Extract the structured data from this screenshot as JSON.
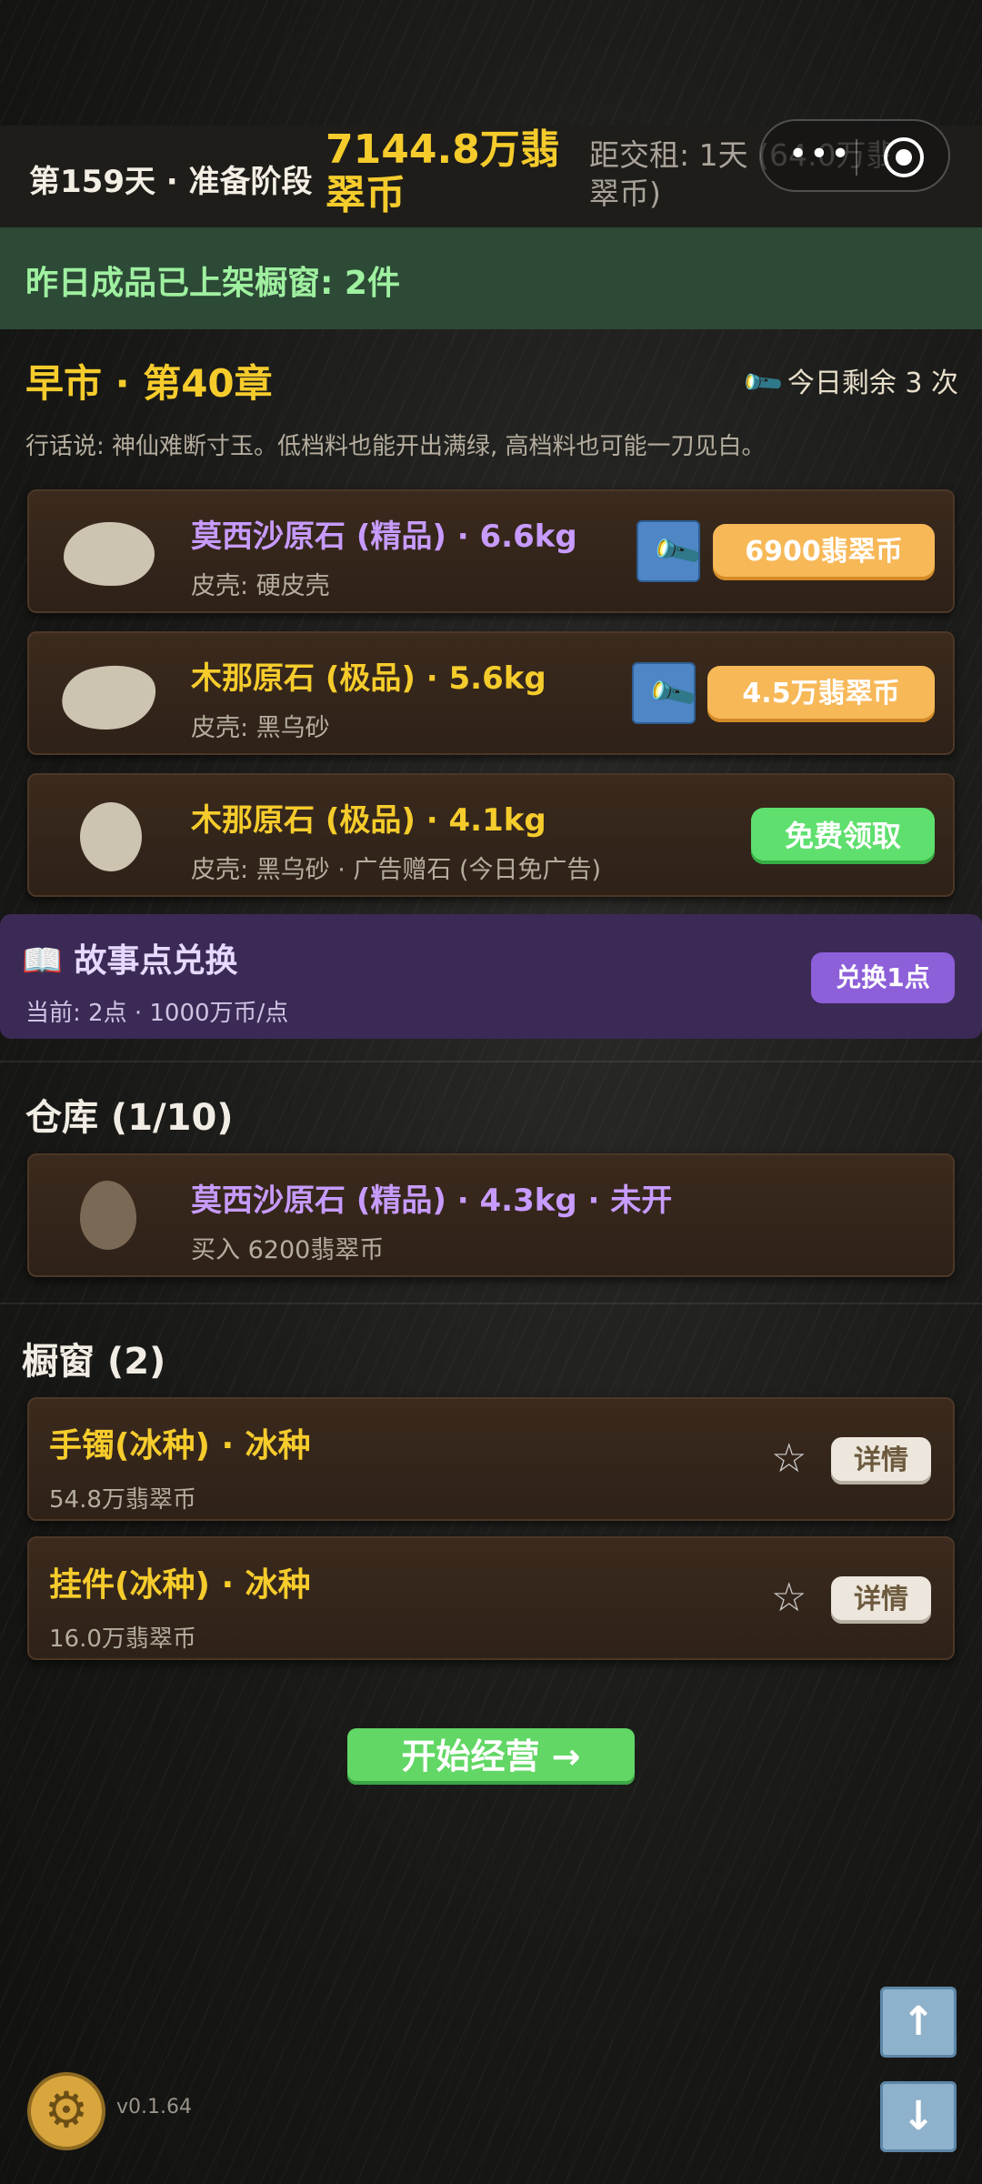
{
  "header": {
    "day_phase": "第159天 · 准备阶段",
    "money": "7144.8万翡翠币",
    "rent_line1": "距交租: 1天 (64.0万翡",
    "rent_line2": "翠币)"
  },
  "banner": {
    "text": "昨日成品已上架橱窗: 2件"
  },
  "market": {
    "title": "早市 · 第40章",
    "remaining": "今日剩余 3 次",
    "saying": "行话说: 神仙难断寸玉。低档料也能开出满绿, 高档料也可能一刀见白。",
    "items": [
      {
        "name": "莫西沙原石 (精品) · 6.6kg",
        "sub": "皮壳: 硬皮壳",
        "price": "6900翡翠币"
      },
      {
        "name": "木那原石 (极品) · 5.6kg",
        "sub": "皮壳: 黑乌砂",
        "price": "4.5万翡翠币"
      },
      {
        "name": "木那原石 (极品) · 4.1kg",
        "sub": "皮壳: 黑乌砂 · 广告赠石 (今日免广告)",
        "action": "免费领取"
      }
    ]
  },
  "story": {
    "icon": "book-icon",
    "title": "故事点兑换",
    "sub": "当前: 2点 · 1000万币/点",
    "button": "兑换1点"
  },
  "warehouse": {
    "title": "仓库 (1/10)",
    "items": [
      {
        "name": "莫西沙原石 (精品) · 4.3kg · 未开",
        "sub": "买入 6200翡翠币"
      }
    ]
  },
  "showcase": {
    "title": "橱窗 (2)",
    "items": [
      {
        "name": "手镯(冰种) · 冰种",
        "price": "54.8万翡翠币",
        "button": "详情"
      },
      {
        "name": "挂件(冰种) · 冰种",
        "price": "16.0万翡翠币",
        "button": "详情"
      }
    ]
  },
  "start_button": "开始经营 →",
  "version": "v0.1.64",
  "colors": {
    "gold": "#f6cc2c",
    "purple": "#c79bff",
    "green_banner": "#2c4a36"
  }
}
